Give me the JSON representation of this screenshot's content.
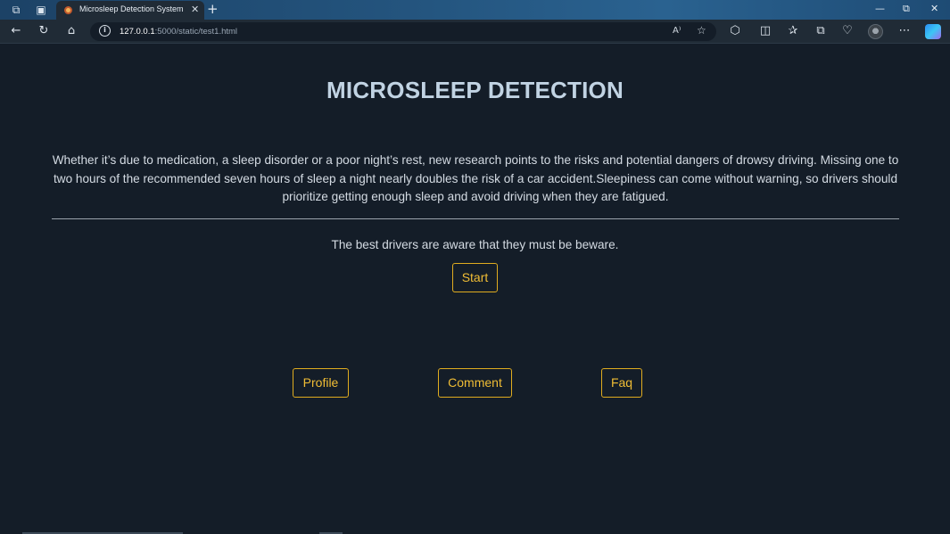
{
  "browser": {
    "tab_title": "Microsleep Detection System",
    "url_host": "127.0.0.1",
    "url_path": ":5000/static/test1.html",
    "read_aloud_label": "A⁾"
  },
  "page": {
    "title": "MICROSLEEP DETECTION",
    "intro": "Whether it’s due to medication, a sleep disorder or a poor night’s rest, new research points to the risks and potential dangers of drowsy driving. Missing one to two hours of the recommended seven hours of sleep a night nearly doubles the risk of a car accident.Sleepiness can come without warning, so drivers should prioritize getting enough sleep and avoid driving when they are fatigued.",
    "tagline": "The best drivers are aware that they must be beware.",
    "start_label": "Start",
    "nav": {
      "profile_label": "Profile",
      "comment_label": "Comment",
      "faq_label": "Faq"
    }
  },
  "colors": {
    "background": "#141d28",
    "title": "#c1d3e3",
    "button_accent": "#e0ac1f"
  }
}
